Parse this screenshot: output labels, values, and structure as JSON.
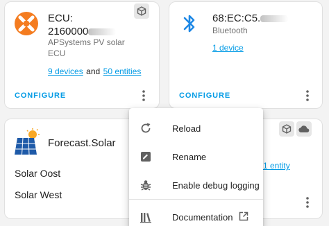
{
  "colors": {
    "accent": "#039be5",
    "apsystems_orange": "#f47c20",
    "bluetooth_blue": "#1e88e5",
    "icon_gray": "#616161"
  },
  "ecu_card": {
    "name_line1": "ECU:",
    "name_line2": "2160000",
    "manufacturer": "APSystems PV solar",
    "model": "ECU",
    "devices_link": "9 devices",
    "and_text": "and",
    "entities_link": "50 entities",
    "configure_label": "CONFIGURE",
    "badge_icon": "package-icon"
  },
  "bluetooth_card": {
    "address": "68:EC:C5.",
    "subtitle": "Bluetooth",
    "device_link": "1 device",
    "configure_label": "CONFIGURE"
  },
  "forecast_card": {
    "title": "Forecast.Solar",
    "entries": [
      "Solar Oost",
      "Solar West"
    ]
  },
  "right_bottom_card": {
    "entity_link": "1 entity",
    "badges": [
      "package-icon",
      "cloud-icon"
    ]
  },
  "menu": {
    "items": [
      {
        "label": "Reload",
        "icon": "reload-icon"
      },
      {
        "label": "Rename",
        "icon": "rename-icon"
      },
      {
        "label": "Enable debug logging",
        "icon": "bug-icon"
      },
      {
        "label": "Documentation",
        "icon": "book-icon",
        "trailing_icon": "open-in-new-icon"
      }
    ]
  }
}
